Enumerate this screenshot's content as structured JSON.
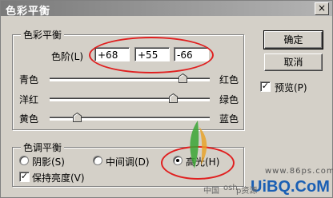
{
  "window": {
    "title": "色彩平衡",
    "close_glyph": "×"
  },
  "color_balance": {
    "legend": "色彩平衡",
    "levels_label": "色阶(L)",
    "levels_values": [
      "+68",
      "+55",
      "-66"
    ],
    "sliders": [
      {
        "left": "青色",
        "right": "红色",
        "value": 68
      },
      {
        "left": "洋红",
        "right": "绿色",
        "value": 55
      },
      {
        "left": "黄色",
        "right": "蓝色",
        "value": -66
      }
    ]
  },
  "tone_balance": {
    "legend": "色调平衡",
    "options": [
      "阴影(S)",
      "中间调(D)",
      "高光(H)"
    ],
    "selected": "高光(H)",
    "preserve_luminosity": {
      "label": "保持亮度(V)",
      "checked": true
    }
  },
  "buttons": {
    "ok": "确定",
    "cancel": "取消"
  },
  "preview": {
    "label": "预览(P)",
    "checked": true
  },
  "watermark": {
    "site": "www.86ps.com",
    "brand": "UiBQ.CoM",
    "partial_text": "中国",
    "partial_text_2": "osh",
    "partial_text_3": "p资源"
  },
  "colors": {
    "annotation": "#e02020",
    "dialog_bg": "#d4d0c8"
  }
}
